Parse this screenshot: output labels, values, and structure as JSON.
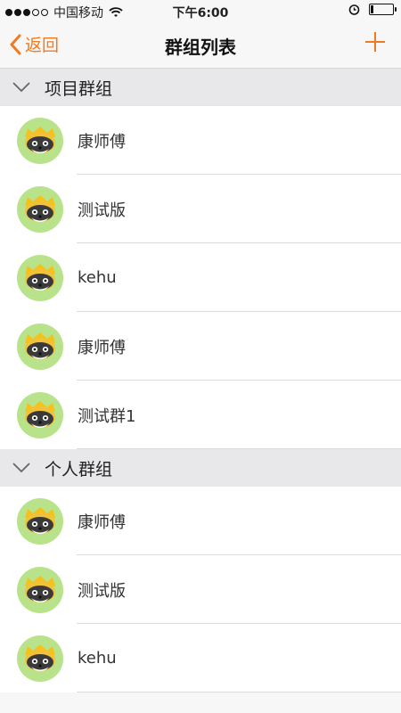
{
  "status": {
    "carrier": "中国移动",
    "time": "下午6:00"
  },
  "nav": {
    "back_label": "返回",
    "title": "群组列表"
  },
  "sections": [
    {
      "title": "项目群组",
      "items": [
        "康师傅",
        "测试版",
        "kehu",
        "康师傅",
        "测试群1"
      ]
    },
    {
      "title": "个人群组",
      "items": [
        "康师傅",
        "测试版",
        "kehu"
      ]
    }
  ],
  "colors": {
    "accent": "#ef7a1f",
    "avatar_bg": "#b9e38a"
  }
}
